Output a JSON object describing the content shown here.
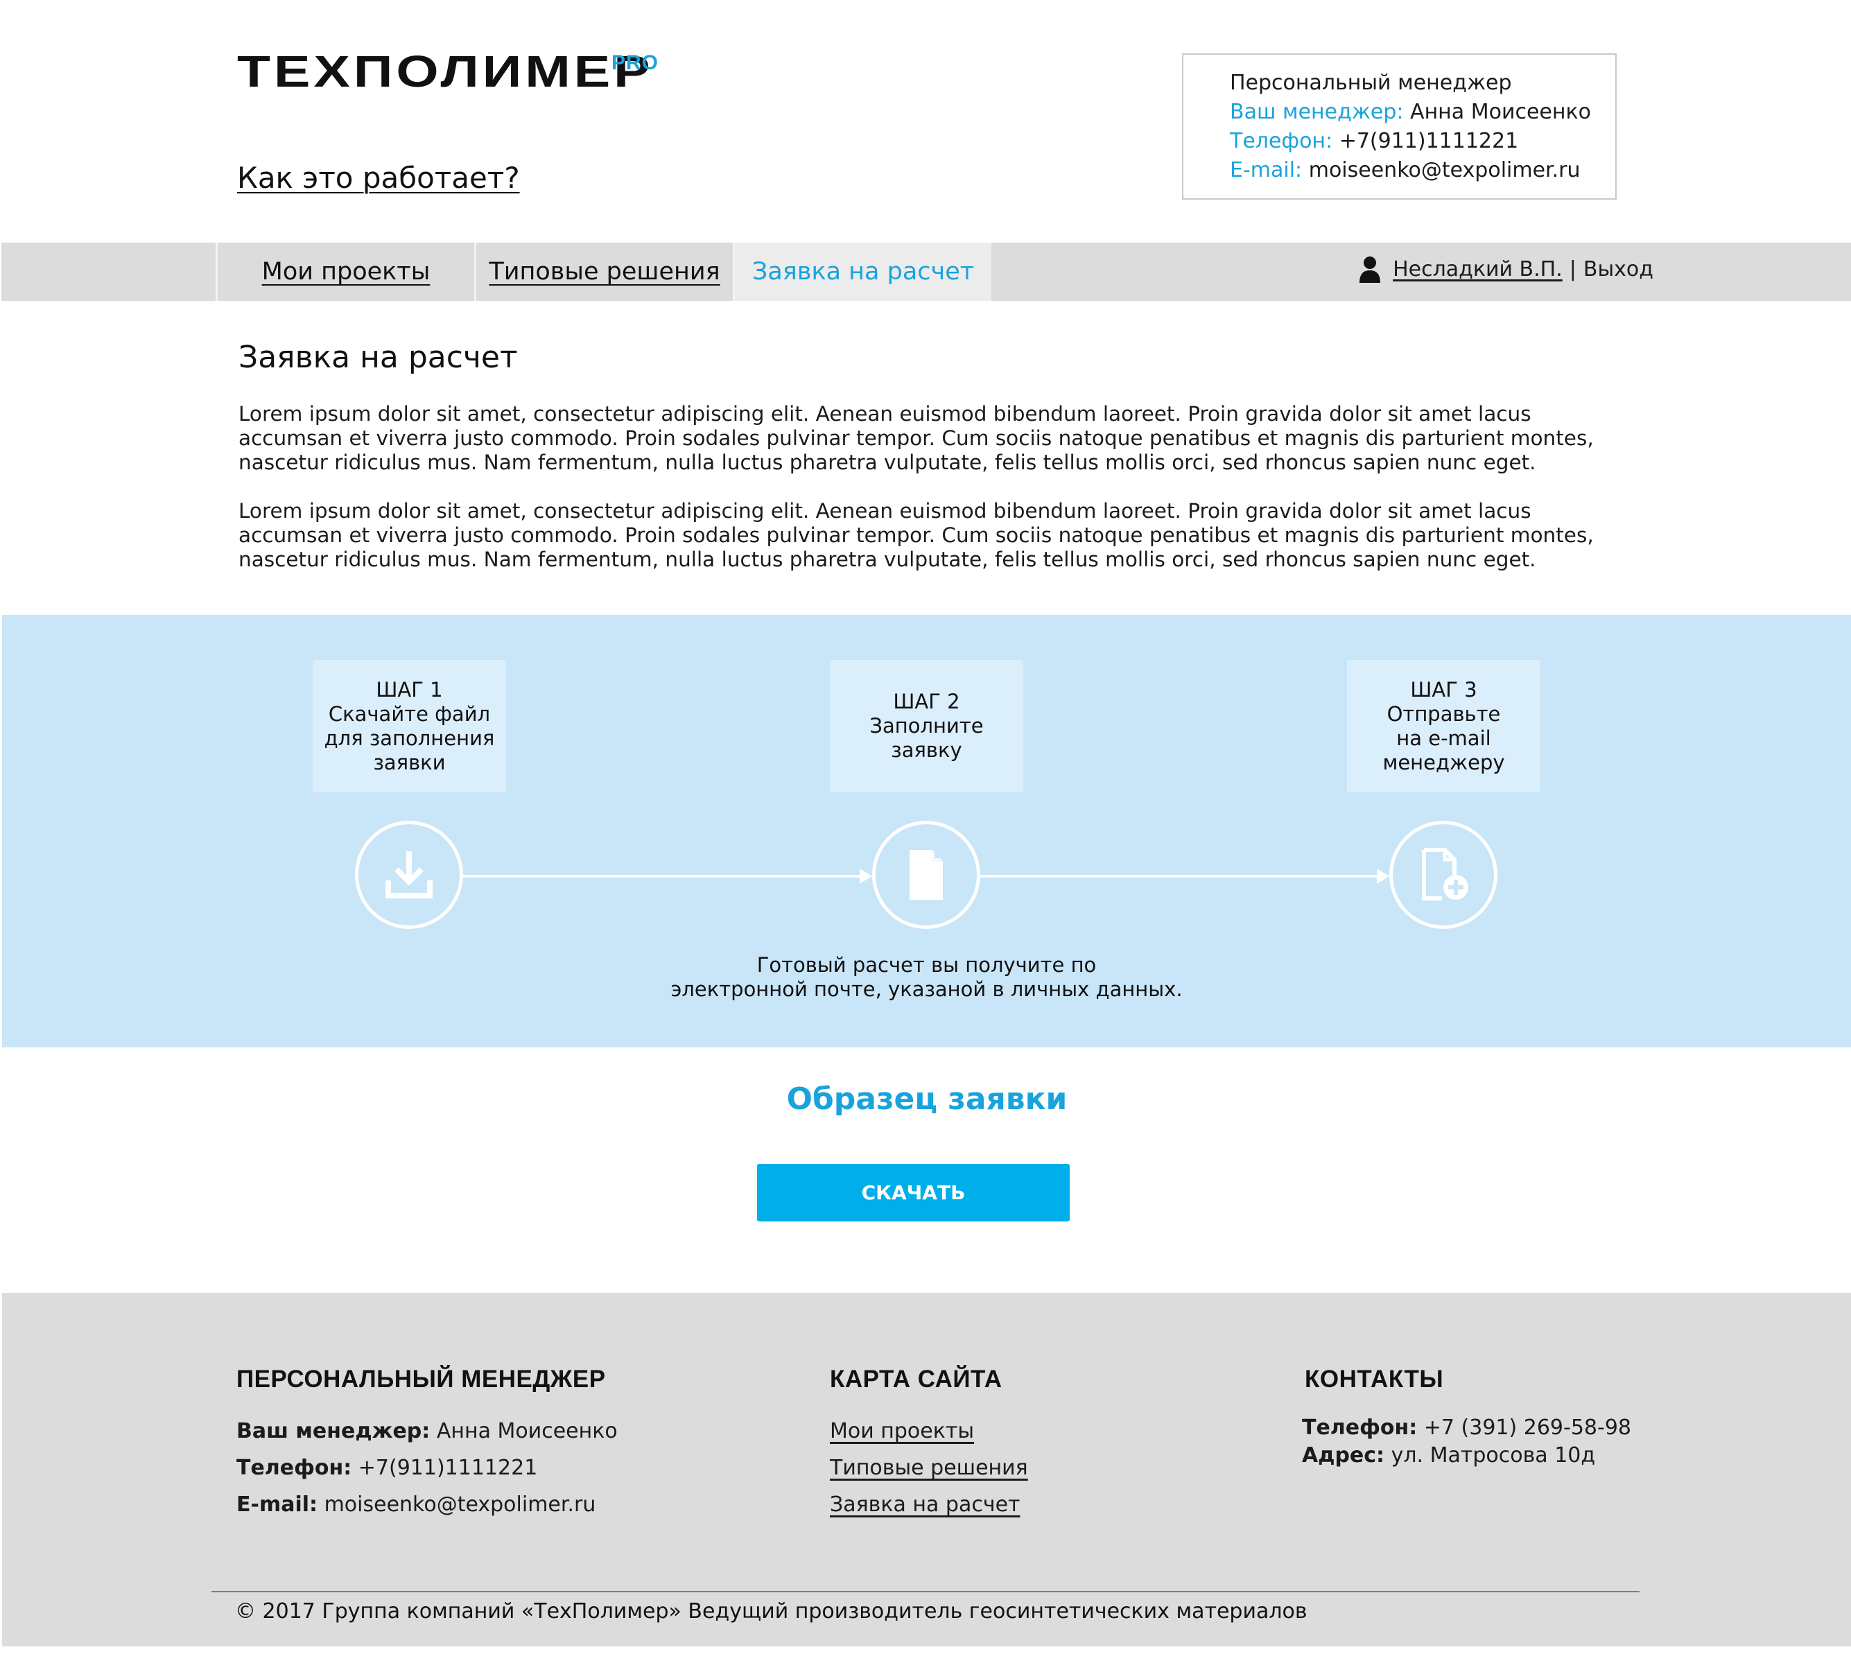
{
  "header": {
    "logo_main": "ТЕХПОЛИМЕР",
    "logo_sup": "PRO",
    "how_it_works": "Как это работает?",
    "manager_box": {
      "title": "Персональный менеджер",
      "manager_label": "Ваш менеджер:",
      "manager_value": "Анна Моисеенко",
      "phone_label": "Телефон:",
      "phone_value": "+7(911)1111221",
      "email_label": "E-mail:",
      "email_value": "moiseenko@texpolimer.ru"
    }
  },
  "nav": {
    "tabs": [
      {
        "label": "Мои проекты",
        "active": false
      },
      {
        "label": "Типовые решения",
        "active": false
      },
      {
        "label": "Заявка на расчет",
        "active": true
      }
    ],
    "user_name": "Несладкий В.П.",
    "separator": "|",
    "logout": "Выход"
  },
  "main": {
    "title": "Заявка на расчет",
    "paragraphs": [
      "Lorem ipsum dolor sit amet, consectetur adipiscing elit. Aenean euismod bibendum laoreet. Proin gravida dolor sit amet lacus accumsan et viverra justo commodo. Proin sodales pulvinar tempor. Cum sociis natoque penatibus et magnis dis parturient montes, nascetur ridiculus mus. Nam fermentum, nulla luctus pharetra vulputate, felis tellus mollis orci, sed rhoncus sapien nunc eget.",
      "Lorem ipsum dolor sit amet, consectetur adipiscing elit. Aenean euismod bibendum laoreet. Proin gravida dolor sit amet lacus accumsan et viverra justo commodo. Proin sodales pulvinar tempor. Cum sociis natoque penatibus et magnis dis parturient montes, nascetur ridiculus mus. Nam fermentum, nulla luctus pharetra vulputate, felis tellus mollis orci, sed rhoncus sapien nunc eget."
    ]
  },
  "steps": {
    "items": [
      {
        "title": "ШАГ 1",
        "lines": [
          "Скачайте файл",
          "для заполнения",
          "заявки"
        ],
        "icon": "download-icon"
      },
      {
        "title": "ШАГ 2",
        "lines": [
          "Заполните",
          "заявку"
        ],
        "icon": "document-icon"
      },
      {
        "title": "ШАГ 3",
        "lines": [
          "Отправьте",
          "на e-mail",
          "менеджеру"
        ],
        "icon": "document-add-icon"
      }
    ],
    "note_line1": "Готовый расчет вы получите по",
    "note_line2": "электронной почте, указаной в личных данных."
  },
  "sample": {
    "title": "Образец заявки",
    "button": "СКАЧАТЬ"
  },
  "footer": {
    "manager": {
      "heading": "ПЕРСОНАЛЬНЫЙ МЕНЕДЖЕР",
      "manager_label": "Ваш менеджер:",
      "manager_value": "Анна Моисеенко",
      "phone_label": "Телефон:",
      "phone_value": "+7(911)1111221",
      "email_label": "E-mail:",
      "email_value": "moiseenko@texpolimer.ru"
    },
    "sitemap": {
      "heading": "КАРТА САЙТА",
      "links": [
        "Мои проекты",
        "Типовые решения",
        "Заявка на расчет"
      ]
    },
    "contacts": {
      "heading": "КОНТАКТЫ",
      "phone_label": "Телефон:",
      "phone_value": "+7 (391) 269-58-98",
      "address_label": "Адрес:",
      "address_value": "ул. Матросова 10д"
    },
    "copyright": "© 2017 Группа компаний «ТехПолимер» Ведущий производитель геосинтетических материалов"
  },
  "colors": {
    "accent": "#19a3dd",
    "button": "#00aeea",
    "steps_bg": "#c9e5f8",
    "nav_bg": "#dcdcdc",
    "footer_bg": "#dcdcdc"
  }
}
